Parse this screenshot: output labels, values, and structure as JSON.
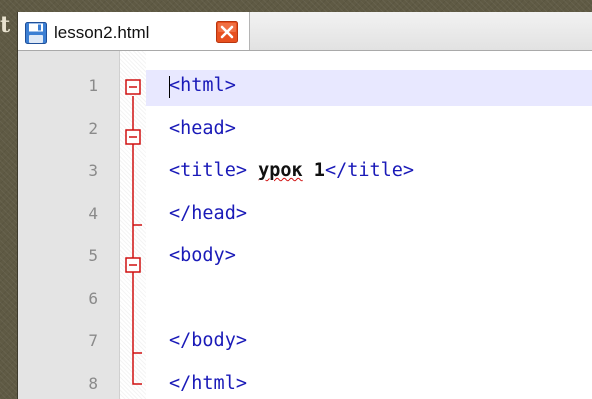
{
  "background": {
    "corner_char": "t"
  },
  "tab": {
    "title": "lesson2.html",
    "save_icon": "floppy-disk-icon",
    "close_icon": "close-x-icon"
  },
  "editor": {
    "current_line": 1,
    "lines": [
      {
        "number": "1",
        "tokens": [
          {
            "text": "<html>",
            "cls": "kw"
          }
        ]
      },
      {
        "number": "2",
        "tokens": [
          {
            "text": "<head>",
            "cls": "kw"
          }
        ]
      },
      {
        "number": "3",
        "tokens": [
          {
            "text": "<title>",
            "cls": "kw"
          },
          {
            "text": " ",
            "cls": "kw"
          },
          {
            "text": "урок",
            "cls": "txt typo"
          },
          {
            "text": " 1",
            "cls": "txt"
          },
          {
            "text": "</title>",
            "cls": "kw"
          }
        ]
      },
      {
        "number": "4",
        "tokens": [
          {
            "text": "</head>",
            "cls": "kw"
          }
        ]
      },
      {
        "number": "5",
        "tokens": [
          {
            "text": "<body>",
            "cls": "kw"
          }
        ]
      },
      {
        "number": "6",
        "tokens": []
      },
      {
        "number": "7",
        "tokens": [
          {
            "text": "</body>",
            "cls": "kw"
          }
        ]
      },
      {
        "number": "8",
        "tokens": [
          {
            "text": "</html>",
            "cls": "kw"
          }
        ]
      }
    ]
  },
  "colors": {
    "fold_marker": "#d01010",
    "keyword": "#1a1ab8",
    "line_highlight": "#e8e8ff",
    "gutter": "#e4e4e4"
  }
}
